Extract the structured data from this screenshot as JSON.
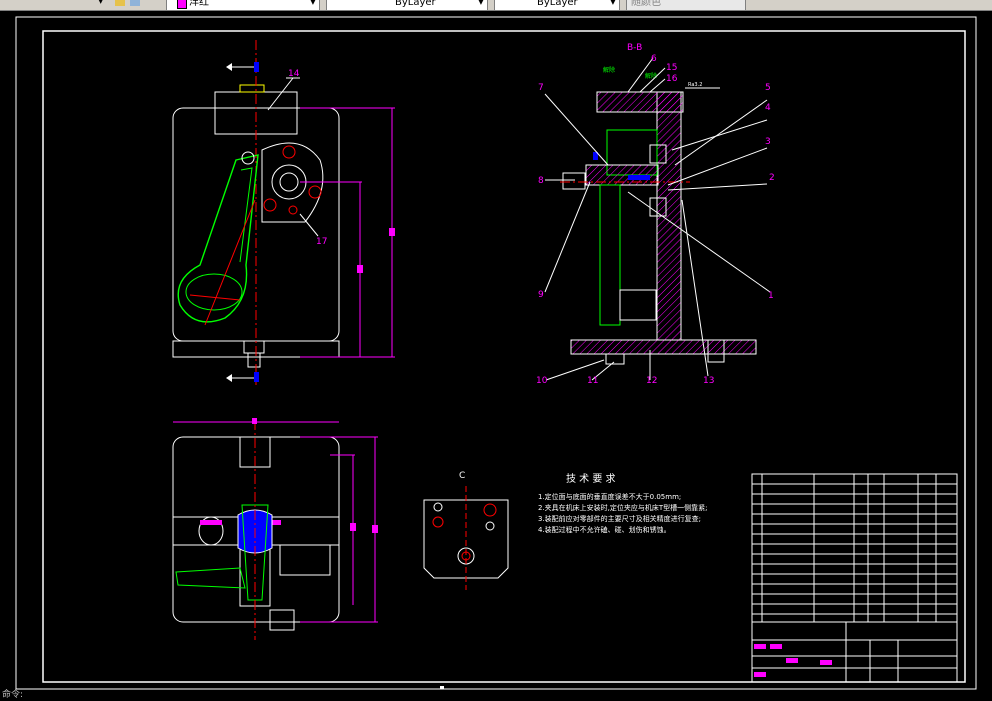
{
  "toolbar": {
    "color_value": "洋红",
    "linetype_value": "ByLayer",
    "lineweight_value": "ByLayer",
    "plotstyle_value": "随颜色"
  },
  "drawing": {
    "section_title": "B-B",
    "view_c_title": "C",
    "tech_title": "技 术 要 求",
    "tech_items": [
      "1.定位面与底面的垂直度误差不大于0.05mm;",
      "2.夹具在机床上安装时,定位夹应与机床T型槽一侧靠紧;",
      "3.装配前应对零部件的主要尺寸及相关精度进行复查;",
      "4.装配过程中不允许磕、碰、划伤和锈蚀。"
    ],
    "callouts": [
      "1",
      "2",
      "3",
      "4",
      "5",
      "6",
      "7",
      "8",
      "9",
      "10",
      "11",
      "12",
      "13",
      "14",
      "15",
      "16",
      "17"
    ]
  },
  "status": {
    "text": "命令:"
  },
  "colors": {
    "background": "#000000",
    "outline": "#ffffff",
    "callout": "#ff00ff",
    "part": "#00ff00",
    "hatch": "#ff00ff",
    "axis": "#ff0000",
    "symbol": "#0000ff"
  }
}
